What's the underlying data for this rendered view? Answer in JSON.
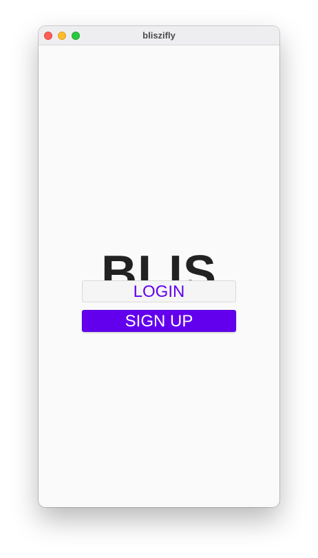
{
  "window": {
    "title": "bliszifly"
  },
  "main": {
    "logo_text": "BLIS",
    "login_label": "LOGIN",
    "signup_label": "SIGN UP"
  },
  "colors": {
    "accent": "#6200ee",
    "logo": "#222222",
    "background": "#fafafa"
  }
}
